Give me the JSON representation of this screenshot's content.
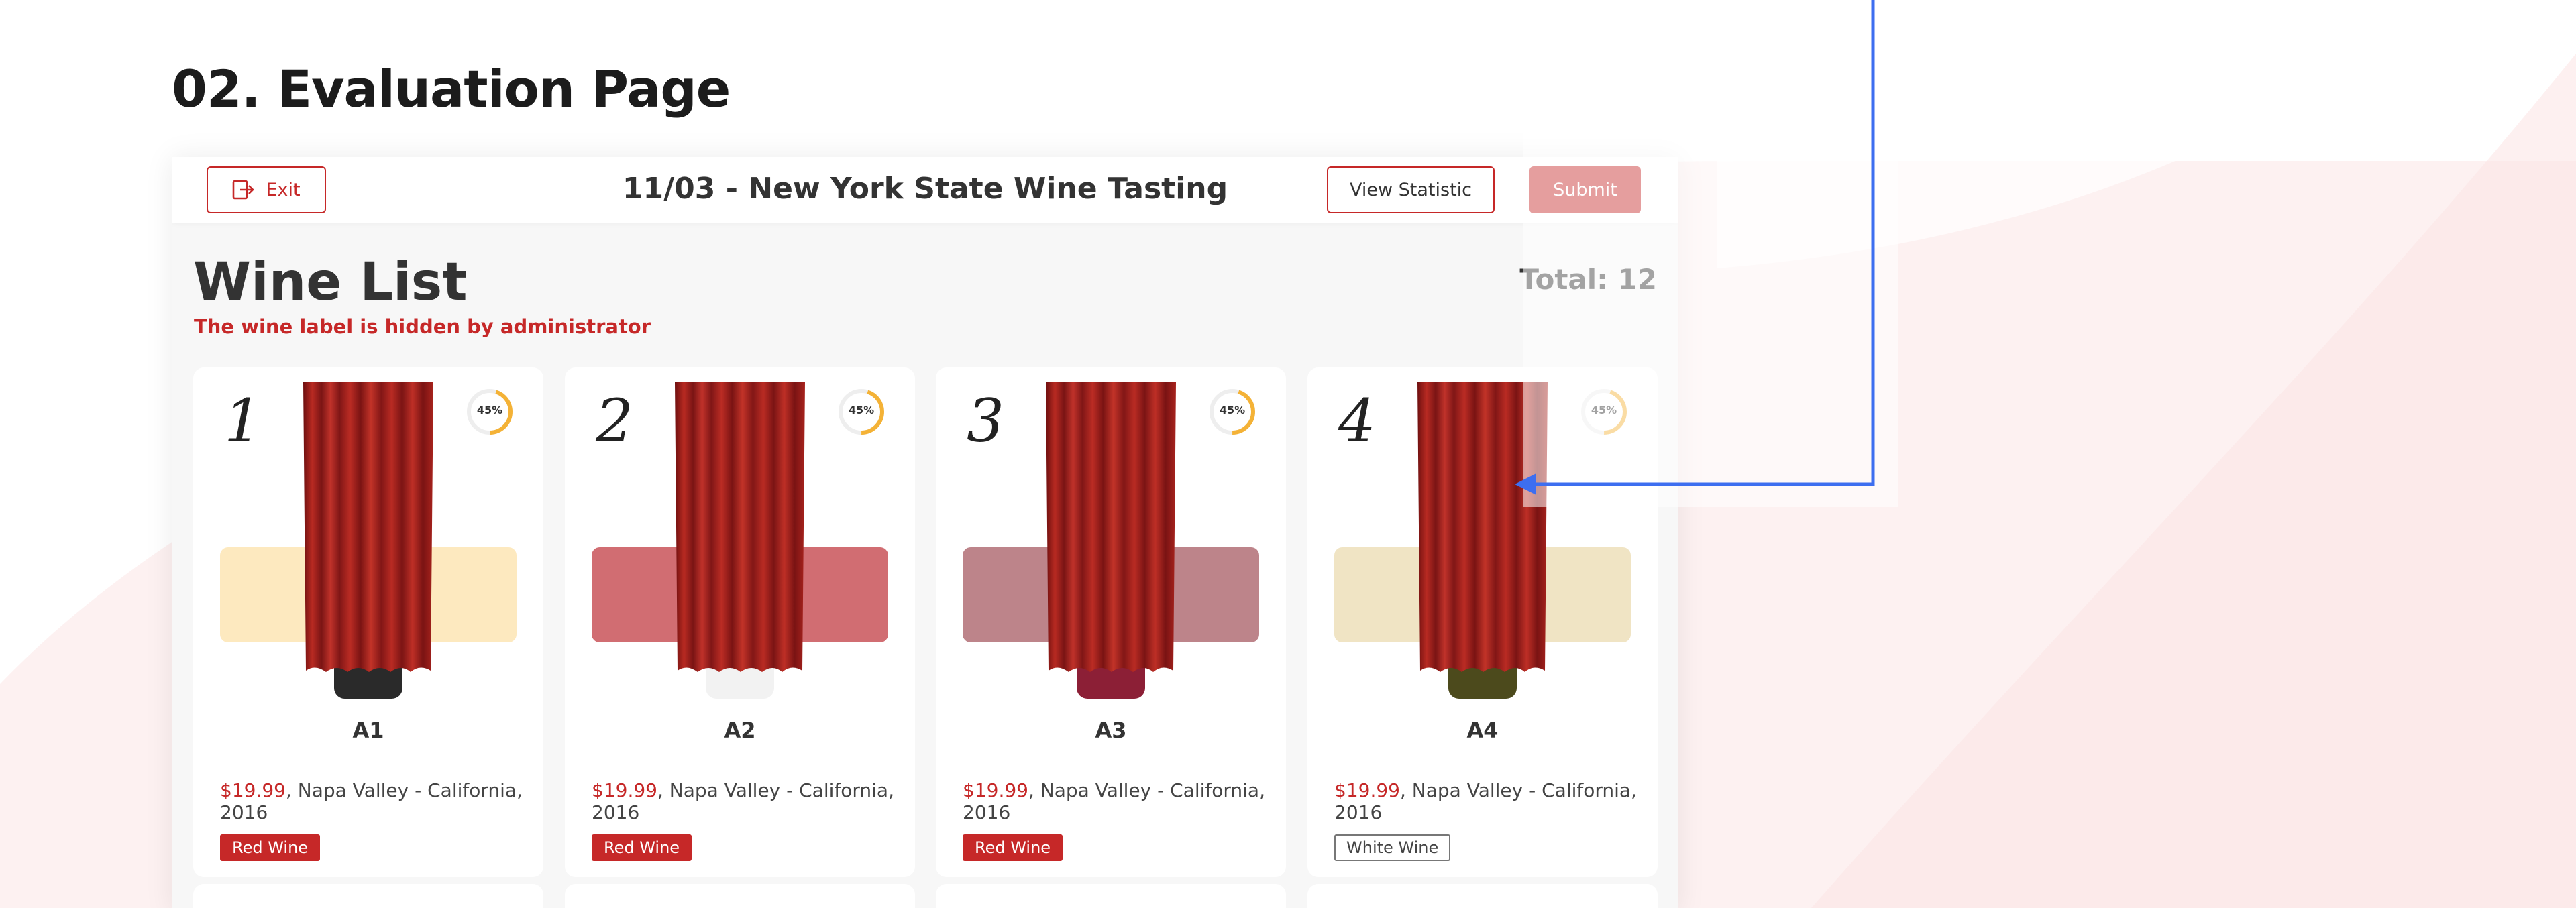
{
  "section_title": "02. Evaluation Page",
  "header": {
    "exit_label": "Exit",
    "event_title": "11/03 - New York State Wine Tasting",
    "view_statistic_label": "View Statistic",
    "submit_label": "Submit"
  },
  "wine_list": {
    "heading": "Wine List",
    "hidden_note": "The wine label is hidden by administrator",
    "total": "Total: 12"
  },
  "cards": [
    {
      "number": "1",
      "code": "A1",
      "progress": "45%",
      "price": "$19.99",
      "origin": ", Napa Valley - California, 2016",
      "type": "Red Wine",
      "swatch_color": "#fde9bf",
      "neck_color": "#2a2a2a"
    },
    {
      "number": "2",
      "code": "A2",
      "progress": "45%",
      "price": "$19.99",
      "origin": ", Napa Valley - California, 2016",
      "type": "Red Wine",
      "swatch_color": "#d16d72",
      "neck_color": "#f2f2f2"
    },
    {
      "number": "3",
      "code": "A3",
      "progress": "45%",
      "price": "$19.99",
      "origin": ", Napa Valley - California, 2016",
      "type": "Red Wine",
      "swatch_color": "#bd848a",
      "neck_color": "#8c1f36"
    },
    {
      "number": "4",
      "code": "A4",
      "progress": "45%",
      "price": "$19.99",
      "origin": ", Napa Valley - California, 2016",
      "type": "White Wine",
      "swatch_color": "#f0e4c4",
      "neck_color": "#4c4a1c"
    }
  ],
  "colors": {
    "accent": "#c62828",
    "progress_ring": "#f4b236",
    "connector_line": "#3d6ef0"
  },
  "icons": {
    "exit": "exit-icon"
  }
}
